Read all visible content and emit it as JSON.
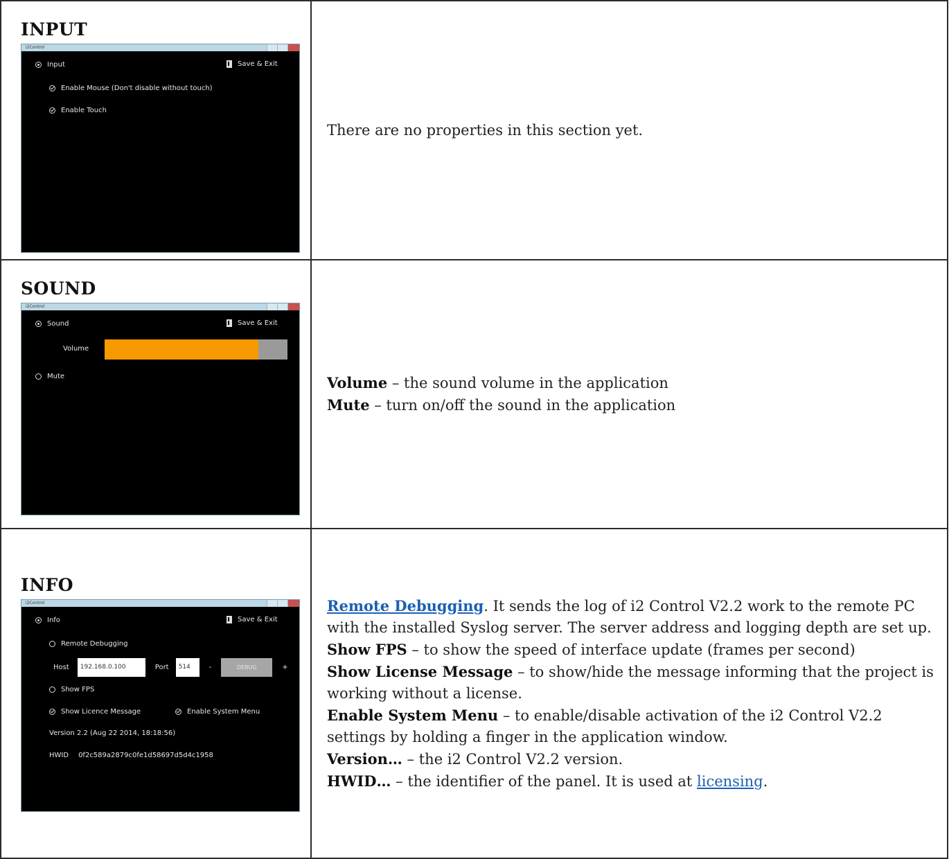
{
  "rows": [
    {
      "title": "INPUT",
      "screen": {
        "window_title": "i2Control",
        "section_label": "Input",
        "save_label": "Save & Exit",
        "options": [
          "Enable Mouse (Don't disable without touch)",
          "Enable Touch"
        ]
      },
      "description": "There are no properties in this section yet."
    },
    {
      "title": "SOUND",
      "screen": {
        "window_title": "i2Control",
        "section_label": "Sound",
        "save_label": "Save & Exit",
        "volume_label": "Volume",
        "volume_level": 0.84,
        "mute_label": "Mute"
      },
      "description": [
        {
          "term": "Volume",
          "text": " – the sound volume in the application"
        },
        {
          "term": "Mute",
          "text": " – turn on/off the sound in the application"
        }
      ]
    },
    {
      "title": "INFO",
      "screen": {
        "window_title": "i2Control",
        "section_label": "Info",
        "save_label": "Save & Exit",
        "remote_debugging_label": "Remote Debugging",
        "host_label": "Host",
        "host_value": "192.168.0.100",
        "port_label": "Port",
        "port_value": "514",
        "minus_label": "-",
        "debug_button": "DEBUG",
        "plus_label": "+",
        "show_fps_label": "Show FPS",
        "show_licence_label": "Show Licence Message",
        "enable_system_menu_label": "Enable System Menu",
        "version_text": "Version 2.2 (Aug 22 2014, 18:18:56)",
        "hwid_label": "HWID",
        "hwid_value": "0f2c589a2879c0fe1d58697d5d4c1958"
      },
      "description": {
        "remote_link": "Remote Debugging",
        "remote_text": ". It sends the log of i2 Control V2.2 work to the remote PC with the installed Syslog server. The server address and logging depth are set up.",
        "items": [
          {
            "term": "Show FPS",
            "text": " – to show the speed of interface update (frames per second)"
          },
          {
            "term": "Show License Message",
            "text": " – to show/hide the message informing that the project is working without a license."
          },
          {
            "term": "Enable System Menu",
            "text": " – to enable/disable activation of the i2 Control V2.2 settings by holding a finger in the application window."
          },
          {
            "term": "Version…",
            "text": " – the i2 Control V2.2 version."
          }
        ],
        "hwid_term": "HWID…",
        "hwid_text": " – the identifier of the panel. It is used at ",
        "licensing_link": "licensing",
        "hwid_end": "."
      }
    }
  ]
}
